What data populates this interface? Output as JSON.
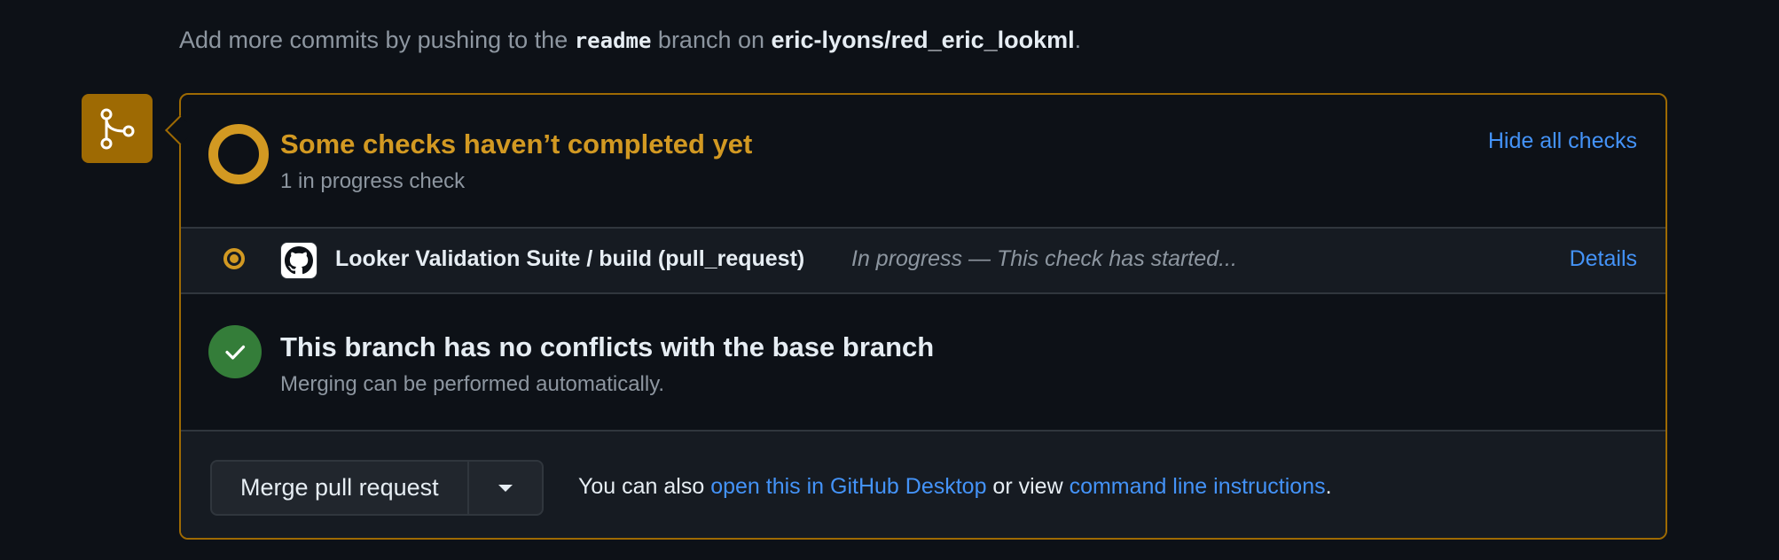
{
  "intro": {
    "prefix": "Add more commits by pushing to the ",
    "branch": "readme",
    "middle": " branch on ",
    "repo": "eric-lyons/red_eric_lookml",
    "suffix": "."
  },
  "checks": {
    "title": "Some checks haven’t completed yet",
    "subtitle": "1 in progress check",
    "hide_all_label": "Hide all checks",
    "items": [
      {
        "name": "Looker Validation Suite / build (pull_request)",
        "status": "In progress — This check has started...",
        "details_label": "Details"
      }
    ]
  },
  "conflicts": {
    "title": "This branch has no conflicts with the base branch",
    "subtitle": "Merging can be performed automatically."
  },
  "merge": {
    "button_label": "Merge pull request",
    "also_text": "You can also ",
    "desktop_link": "open this in GitHub Desktop",
    "or_view_text": " or view ",
    "cli_link": "command line instructions",
    "end_text": "."
  },
  "colors": {
    "pending": "#d29922",
    "success": "#347d39",
    "link": "#4493f8",
    "background": "#0d1117",
    "border_pending": "#9e6a03"
  },
  "icons": {
    "merge_status": "git-merge-icon",
    "pending": "pending-ring-icon",
    "check_in_progress": "in-progress-dot-icon",
    "app": "github-logo-icon",
    "success": "check-circle-icon",
    "dropdown": "triangle-down-icon"
  }
}
